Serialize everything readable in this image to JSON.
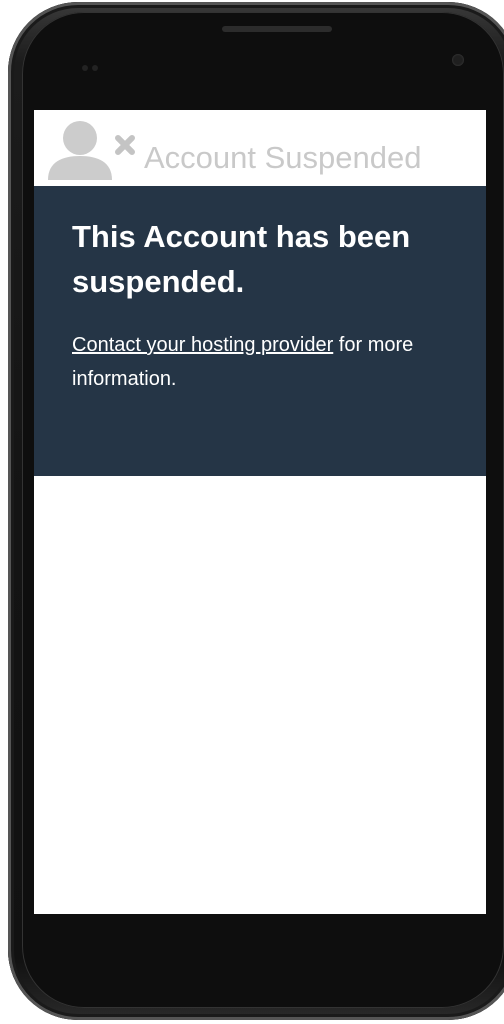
{
  "header": {
    "title": "Account Suspended",
    "icon": "user-x-icon"
  },
  "panel": {
    "heading": "This Account has been suspended.",
    "link_text": "Contact your hosting provider",
    "body_suffix": " for more information."
  },
  "colors": {
    "panel_background": "#253546",
    "header_text": "#c9c9c9",
    "icon": "#cccccc",
    "phone_body": "#141414"
  }
}
